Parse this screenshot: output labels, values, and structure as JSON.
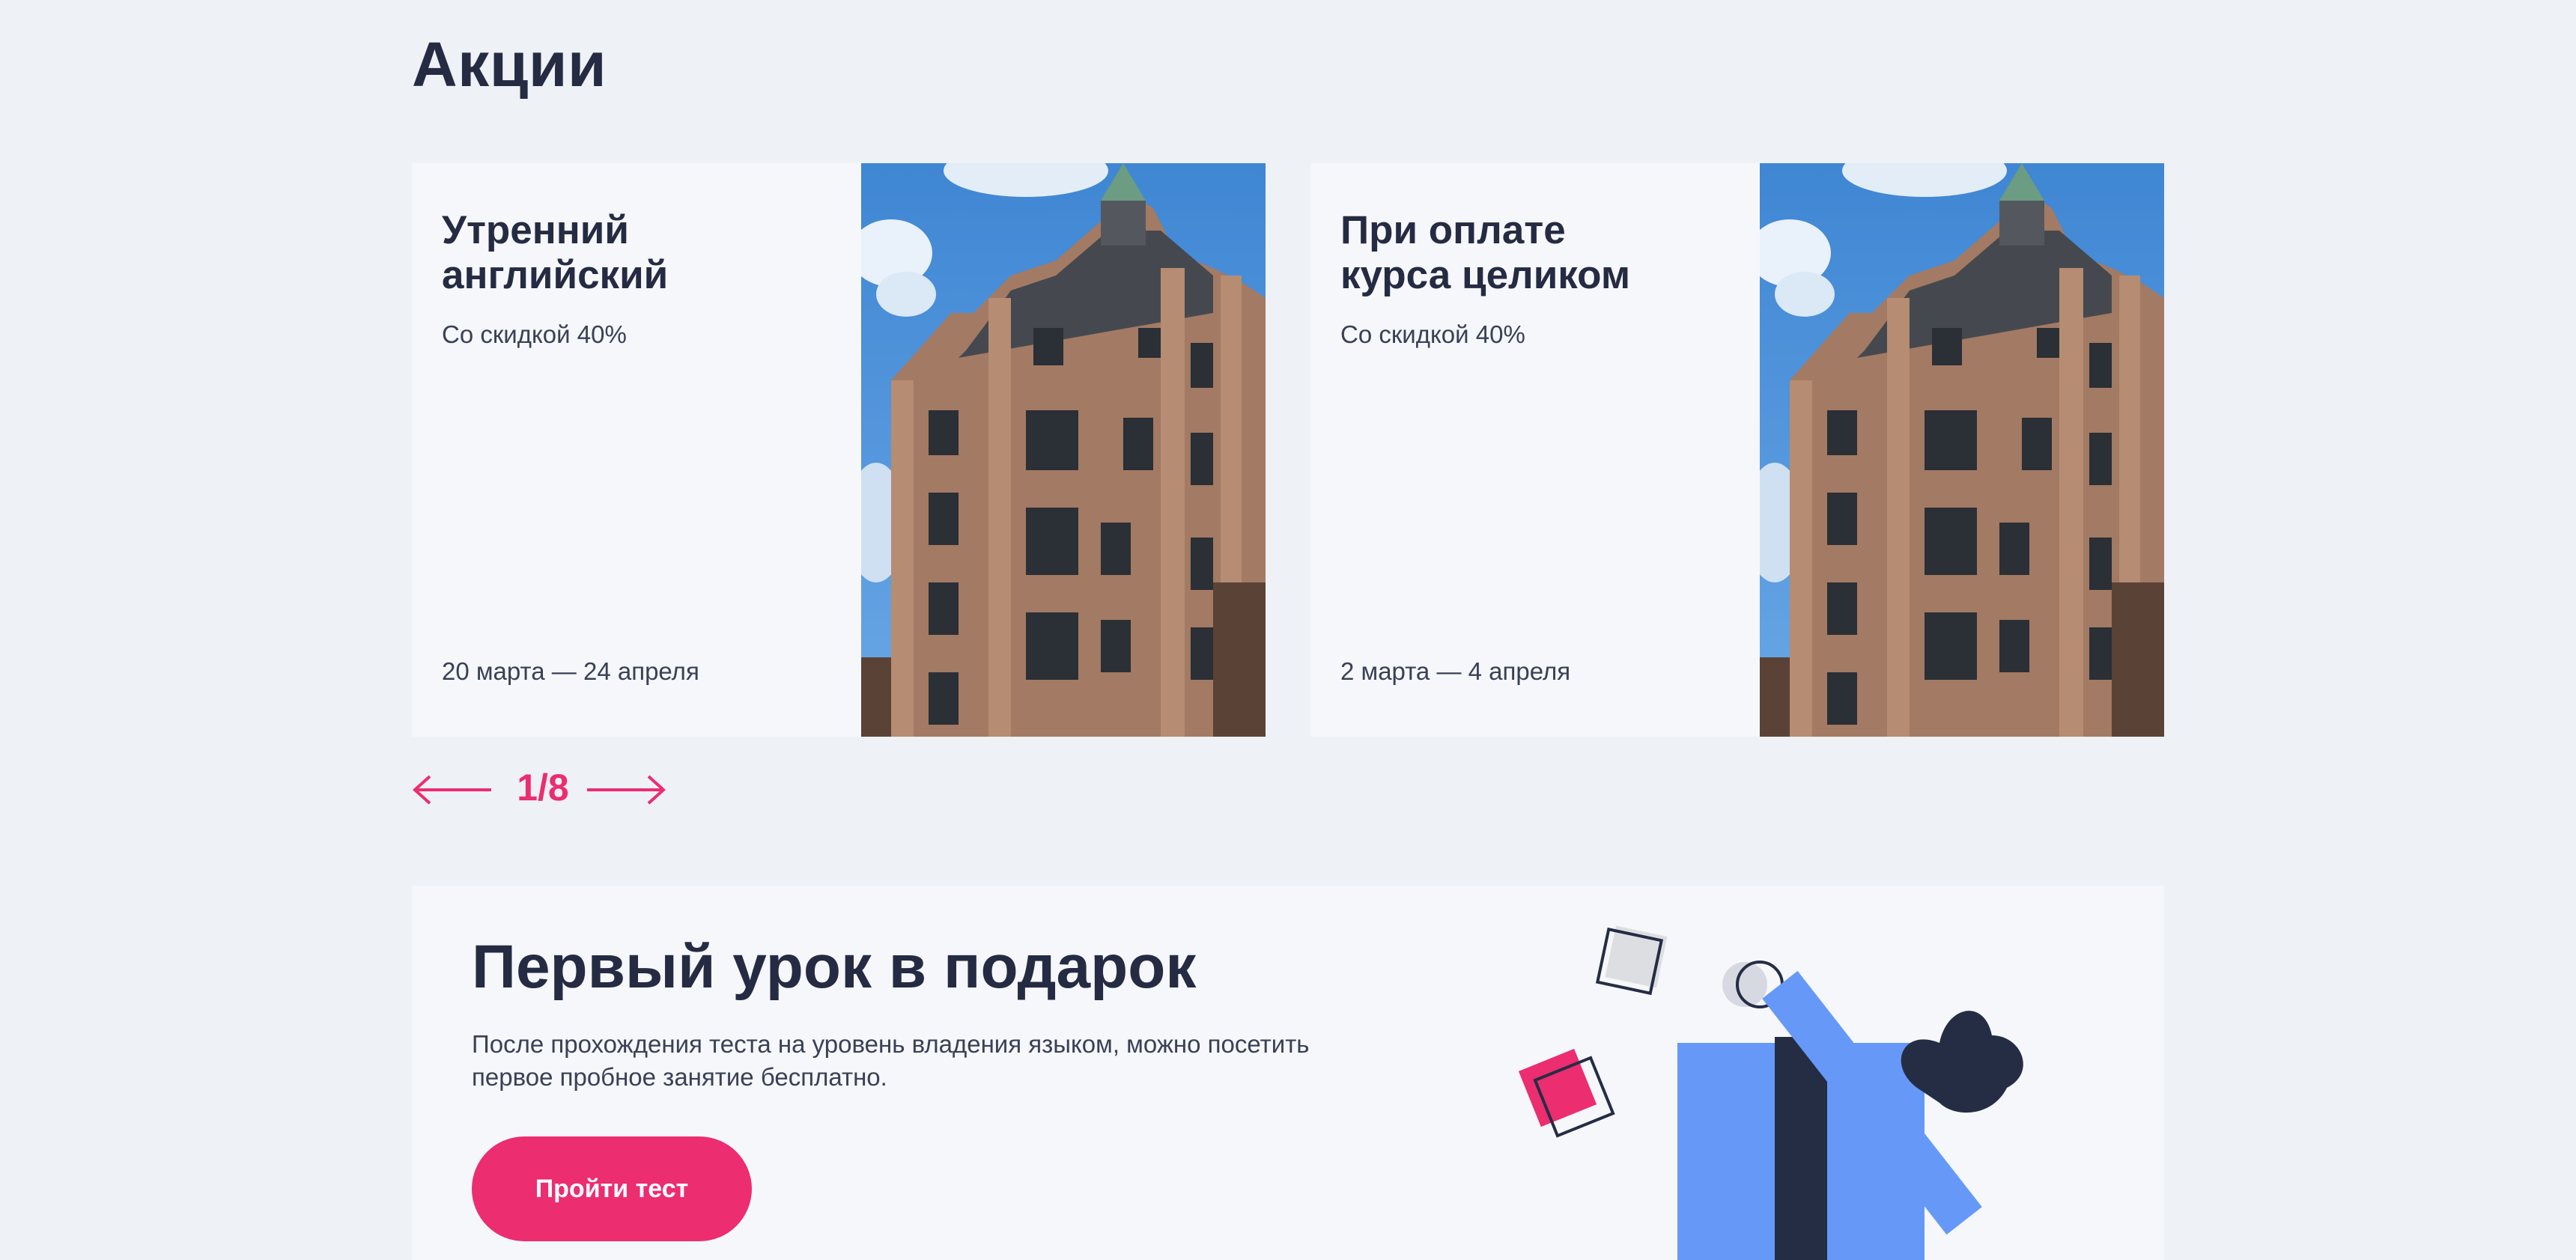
{
  "section": {
    "title": "Акции"
  },
  "cards": [
    {
      "title": "Утренний\nанглийский",
      "subtitle": "Со скидкой 40%",
      "dates": "20 марта — 24 апреля",
      "image": "building-photo"
    },
    {
      "title": "При оплате\nкурса целиком",
      "subtitle": "Со скидкой 40%",
      "dates": "2 марта — 4 апреля",
      "image": "building-photo"
    }
  ],
  "pager": {
    "current": "1/8",
    "prev_icon": "arrow-left-icon",
    "next_icon": "arrow-right-icon"
  },
  "promo": {
    "title": "Первый урок в подарок",
    "description": "После прохождения теста на уровень владения языком, можно посетить первое пробное занятие бесплатно.",
    "button_label": "Пройти тест",
    "illustration": "gift-box-illustration"
  },
  "colors": {
    "accent": "#ec2d6f",
    "text": "#252b42",
    "background": "#eef1f6",
    "card": "#f5f7fb",
    "gift_blue": "#6699f7",
    "gift_ribbon": "#252d44"
  }
}
